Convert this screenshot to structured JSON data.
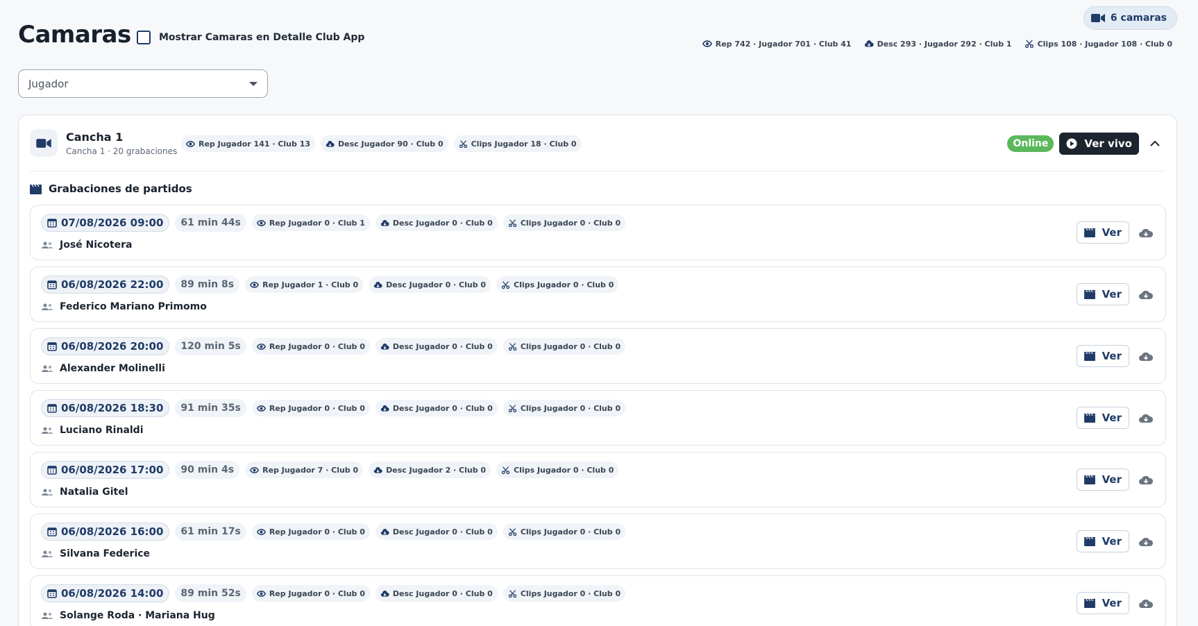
{
  "header": {
    "title": "Camaras",
    "checkbox_label": "Mostrar Camaras en Detalle Club App",
    "cameras_count": "6 camaras",
    "stats": {
      "rep": "Rep 742 · Jugador 701 · Club 41",
      "desc": "Desc 293 · Jugador 292 · Club 1",
      "clips": "Clips 108 · Jugador 108 · Club 0"
    }
  },
  "filter": {
    "selected": "Jugador"
  },
  "camera": {
    "name": "Cancha 1",
    "subtitle": "Cancha 1 · 20 grabaciones",
    "rep": "Rep Jugador 141 · Club 13",
    "desc": "Desc Jugador 90 · Club 0",
    "clips": "Clips Jugador 18 · Club 0",
    "status": "Online",
    "live_label": "Ver vivo"
  },
  "section": {
    "title": "Grabaciones de partidos"
  },
  "recordings": [
    {
      "date": "07/08/2026 09:00",
      "duration": "61 min 44s",
      "rep": "Rep Jugador 0 · Club 1",
      "desc": "Desc Jugador 0 · Club 0",
      "clips": "Clips Jugador 0 · Club 0",
      "players": "José Nicotera",
      "ver": "Ver"
    },
    {
      "date": "06/08/2026 22:00",
      "duration": "89 min 8s",
      "rep": "Rep Jugador 1 · Club 0",
      "desc": "Desc Jugador 0 · Club 0",
      "clips": "Clips Jugador 0 · Club 0",
      "players": "Federico Mariano Primomo",
      "ver": "Ver"
    },
    {
      "date": "06/08/2026 20:00",
      "duration": "120 min 5s",
      "rep": "Rep Jugador 0 · Club 0",
      "desc": "Desc Jugador 0 · Club 0",
      "clips": "Clips Jugador 0 · Club 0",
      "players": "Alexander Molinelli",
      "ver": "Ver"
    },
    {
      "date": "06/08/2026 18:30",
      "duration": "91 min 35s",
      "rep": "Rep Jugador 0 · Club 0",
      "desc": "Desc Jugador 0 · Club 0",
      "clips": "Clips Jugador 0 · Club 0",
      "players": "Luciano Rinaldi",
      "ver": "Ver"
    },
    {
      "date": "06/08/2026 17:00",
      "duration": "90 min 4s",
      "rep": "Rep Jugador 7 · Club 0",
      "desc": "Desc Jugador 2 · Club 0",
      "clips": "Clips Jugador 0 · Club 0",
      "players": "Natalia Gitel",
      "ver": "Ver"
    },
    {
      "date": "06/08/2026 16:00",
      "duration": "61 min 17s",
      "rep": "Rep Jugador 0 · Club 0",
      "desc": "Desc Jugador 0 · Club 0",
      "clips": "Clips Jugador 0 · Club 0",
      "players": "Silvana Federice",
      "ver": "Ver"
    },
    {
      "date": "06/08/2026 14:00",
      "duration": "89 min 52s",
      "rep": "Rep Jugador 0 · Club 0",
      "desc": "Desc Jugador 0 · Club 0",
      "clips": "Clips Jugador 0 · Club 0",
      "players": "Solange Roda · Mariana Hug",
      "ver": "Ver"
    }
  ],
  "colors": {
    "accent": "#1f3b66",
    "online": "#5cb85c",
    "dark": "#1c2430"
  },
  "icons": [
    "video-camera-icon",
    "eye-icon",
    "cloud-icon",
    "scissors-icon",
    "calendar-icon",
    "people-icon",
    "clapperboard-icon",
    "play-circle-icon",
    "chevron-up-icon",
    "cloud-download-icon"
  ]
}
